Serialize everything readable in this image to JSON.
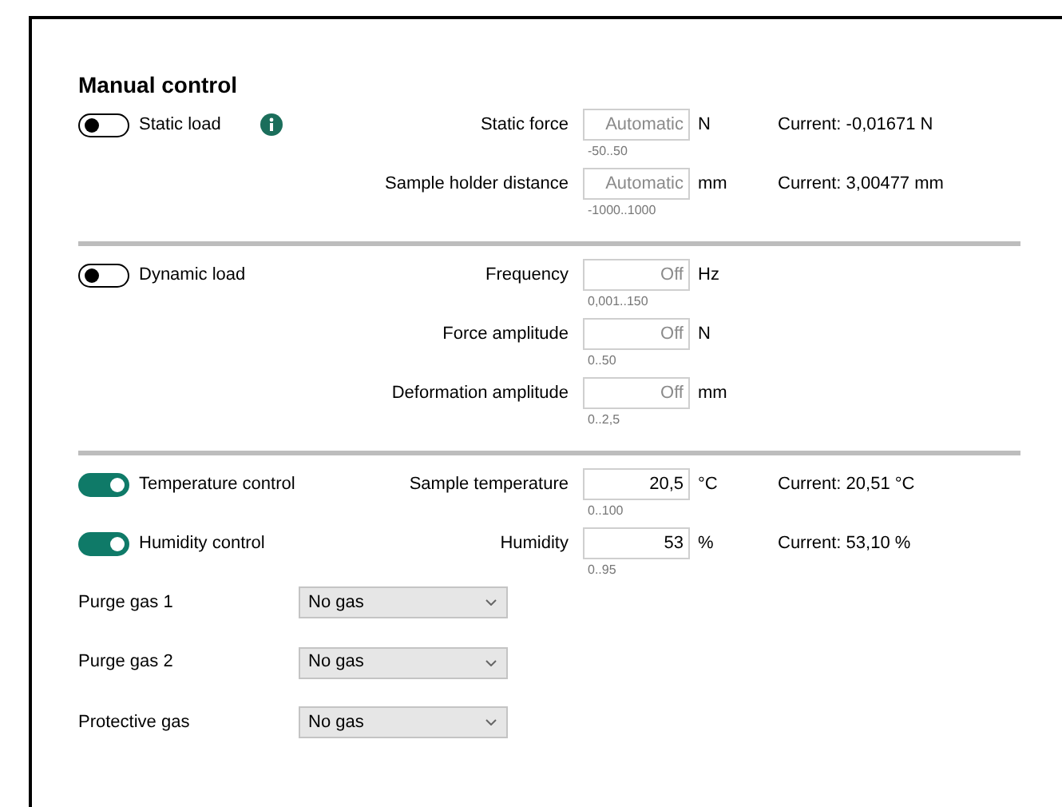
{
  "title": "Manual control",
  "sections": [
    {
      "rows": [
        {
          "toggle": {
            "label": "Static load",
            "on": false,
            "info": true
          },
          "param": {
            "label": "Static force",
            "placeholder": "Automatic",
            "range": "-50..50",
            "unit": "N",
            "current": "Current: -0,01671 N"
          }
        },
        {
          "param": {
            "label": "Sample holder distance",
            "placeholder": "Automatic",
            "range": "-1000..1000",
            "unit": "mm",
            "current": "Current: 3,00477 mm"
          }
        }
      ]
    },
    {
      "rows": [
        {
          "toggle": {
            "label": "Dynamic load",
            "on": false,
            "info": false
          },
          "param": {
            "label": "Frequency",
            "placeholder": "Off",
            "range": "0,001..150",
            "unit": "Hz"
          }
        },
        {
          "param": {
            "label": "Force amplitude",
            "placeholder": "Off",
            "range": "0..50",
            "unit": "N"
          }
        },
        {
          "param": {
            "label": "Deformation amplitude",
            "placeholder": "Off",
            "range": "0..2,5",
            "unit": "mm"
          }
        }
      ]
    },
    {
      "rows": [
        {
          "toggle": {
            "label": "Temperature control",
            "on": true,
            "info": false
          },
          "param": {
            "label": "Sample temperature",
            "value": "20,5",
            "range": "0..100",
            "unit": "°C",
            "current": "Current: 20,51 °C"
          }
        },
        {
          "toggle": {
            "label": "Humidity control",
            "on": true,
            "info": false
          },
          "param": {
            "label": "Humidity",
            "value": "53",
            "range": "0..95",
            "unit": "%",
            "current": "Current: 53,10 %"
          }
        }
      ]
    }
  ],
  "gases": [
    {
      "label": "Purge gas 1",
      "value": "No gas"
    },
    {
      "label": "Purge gas 2",
      "value": "No gas"
    },
    {
      "label": "Protective gas",
      "value": "No gas"
    }
  ]
}
